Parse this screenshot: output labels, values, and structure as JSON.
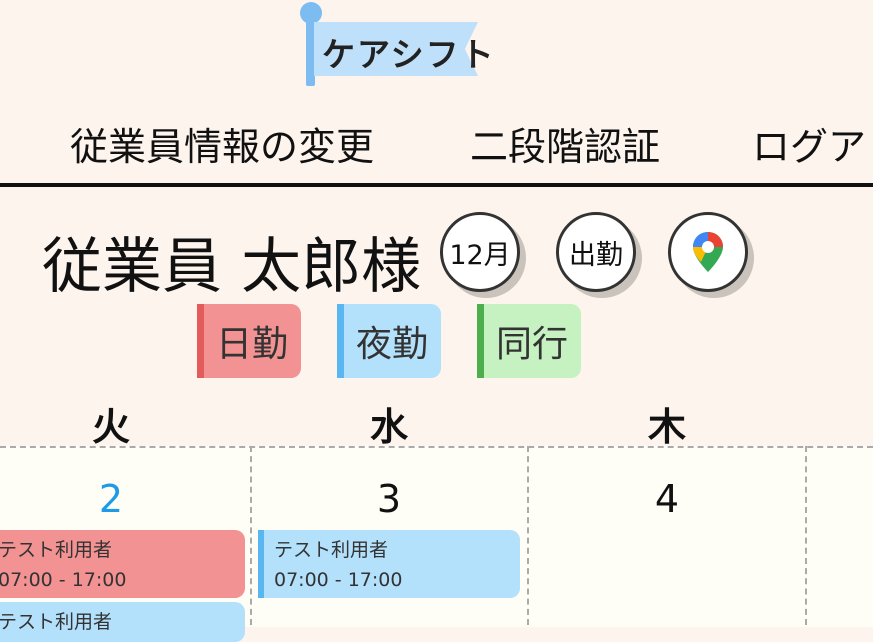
{
  "logo": {
    "text": "ケアシフト"
  },
  "nav": {
    "items": [
      "従業員情報の変更",
      "二段階認証",
      "ログア"
    ]
  },
  "user": {
    "name": "従業員 太郎様"
  },
  "buttons": {
    "month": "12月",
    "attend": "出勤",
    "map_icon": "map-pin-icon"
  },
  "legend": {
    "items": [
      {
        "label": "日勤",
        "color": "#f29292",
        "border": "#e45b5b"
      },
      {
        "label": "夜勤",
        "color": "#b3e0fb",
        "border": "#5ab6f0"
      },
      {
        "label": "同行",
        "color": "#c6f2c2",
        "border": "#4cae4c"
      }
    ]
  },
  "calendar": {
    "days": [
      {
        "weekday": "火",
        "date": "2",
        "date_color": "#1e9be8"
      },
      {
        "weekday": "水",
        "date": "3",
        "date_color": "#111111"
      },
      {
        "weekday": "木",
        "date": "4",
        "date_color": "#111111"
      }
    ],
    "shifts": [
      {
        "day": "2",
        "name": "テスト利用者",
        "time": "07:00 - 17:00",
        "type": "日勤"
      },
      {
        "day": "2",
        "name": "テスト利用者",
        "time": "",
        "type": "夜勤"
      },
      {
        "day": "3",
        "name": "テスト利用者",
        "time": "07:00 - 17:00",
        "type": "夜勤"
      }
    ]
  }
}
